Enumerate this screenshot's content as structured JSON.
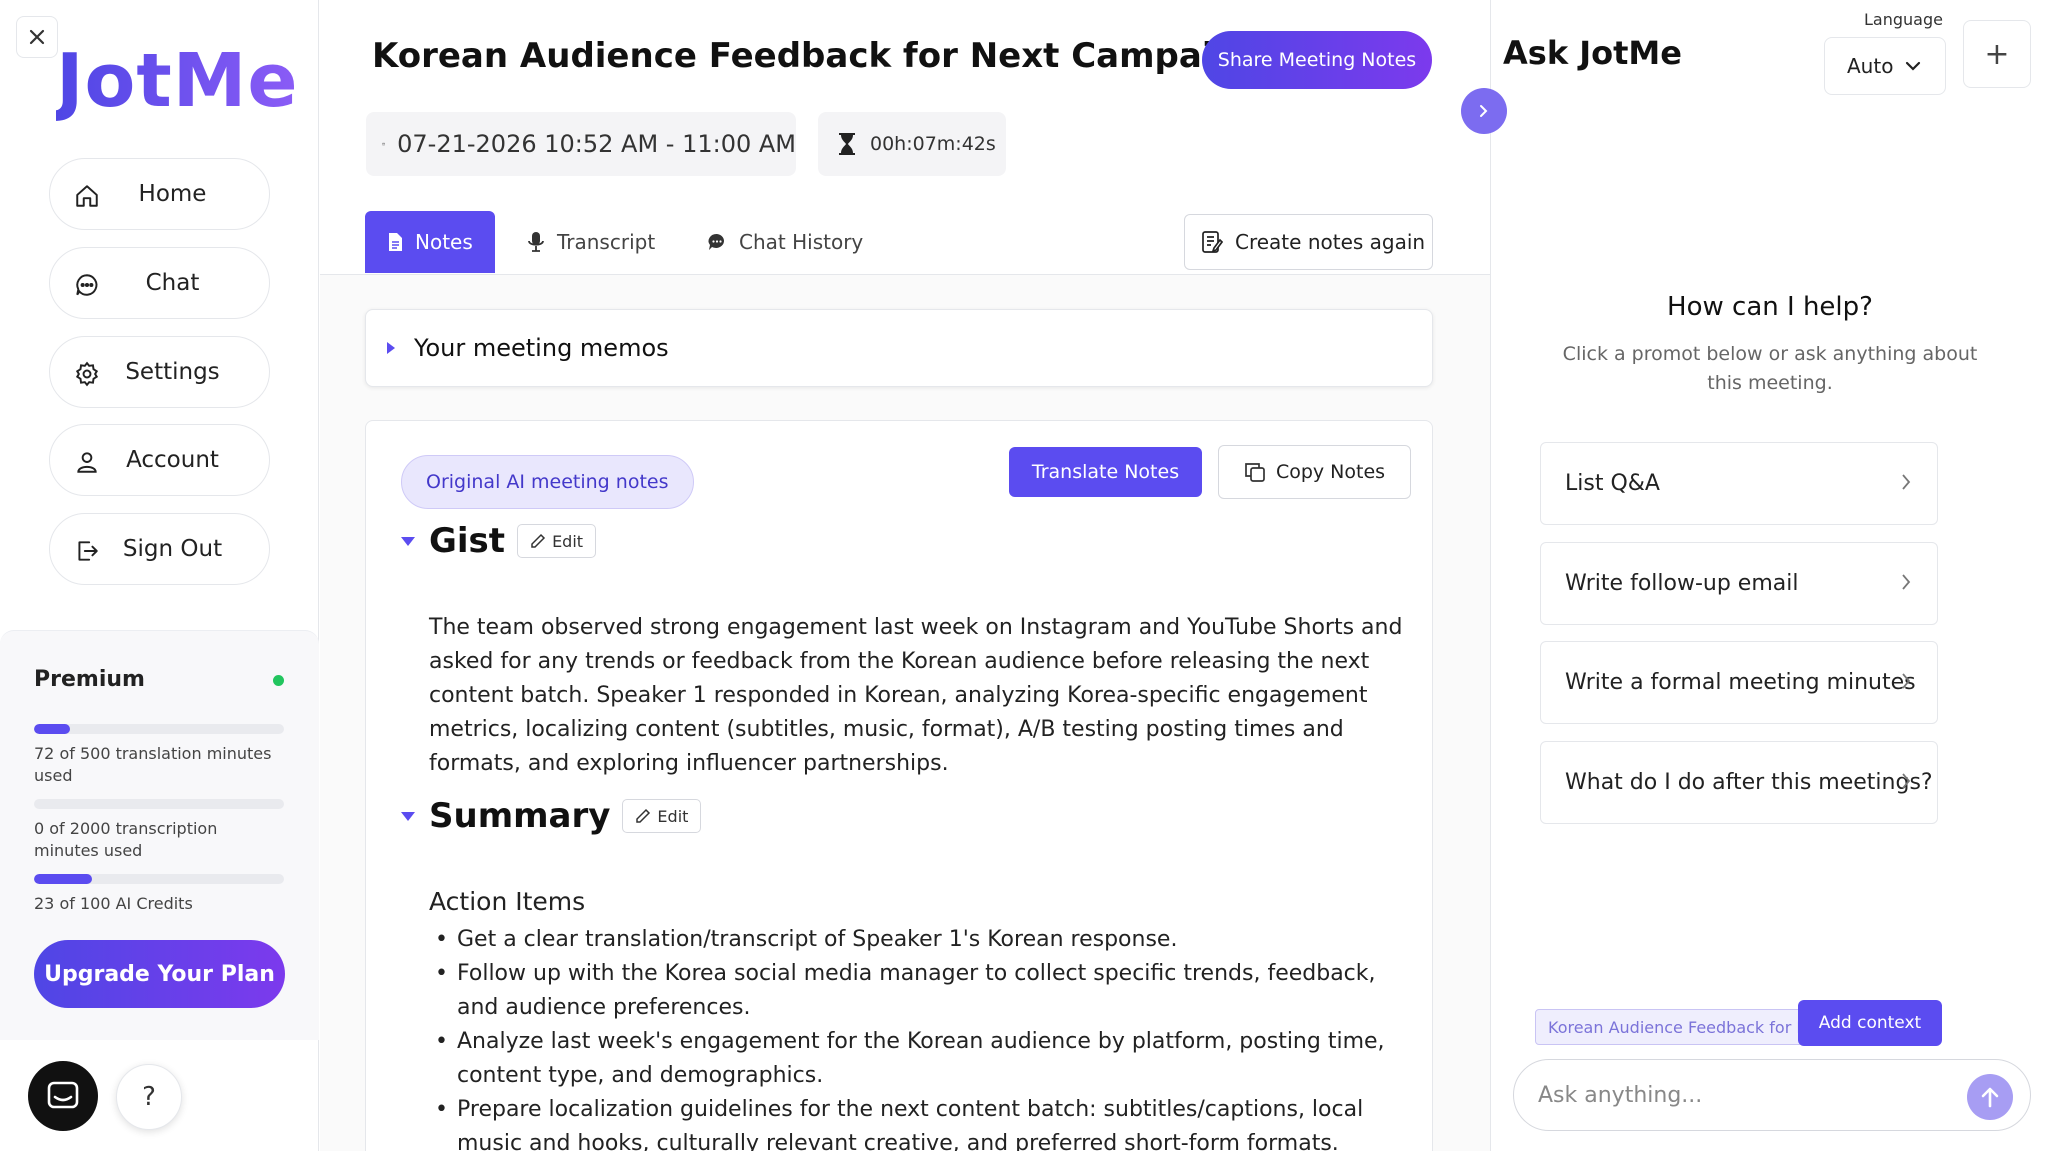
{
  "app": {
    "name": "JotMe"
  },
  "sidebar": {
    "items": [
      {
        "label": "Home",
        "icon": "home-icon"
      },
      {
        "label": "Chat",
        "icon": "chat-icon"
      },
      {
        "label": "Settings",
        "icon": "gear-icon"
      },
      {
        "label": "Account",
        "icon": "user-icon"
      },
      {
        "label": "Sign Out",
        "icon": "sign-out-icon"
      }
    ],
    "plan": {
      "name": "Premium",
      "status_color": "#22c55e",
      "translation_text": "72 of 500 translation minutes used",
      "translation_fraction": 0.144,
      "transcription_text": "0 of 2000 transcription minutes used",
      "transcription_fraction": 0,
      "credits_text": "23 of 100 AI Credits",
      "credits_fraction": 0.23,
      "upgrade_label": "Upgrade Your Plan"
    },
    "help_label": "?"
  },
  "meeting": {
    "title": "Korean Audience Feedback for Next Campaign",
    "share_label": "Share Meeting Notes",
    "datetime": "07-21-2026 10:52 AM - 11:00 AM",
    "duration": "00h:07m:42s"
  },
  "tabs": [
    {
      "label": "Notes",
      "active": true
    },
    {
      "label": "Transcript",
      "active": false
    },
    {
      "label": "Chat History",
      "active": false
    }
  ],
  "recreate_label": "Create notes again",
  "memos": {
    "title": "Your meeting memos"
  },
  "notes": {
    "original_label": "Original AI meeting notes",
    "translate_label": "Translate Notes",
    "copy_label": "Copy Notes",
    "edit_label": "Edit",
    "gist_title": "Gist",
    "gist_text": "The team observed strong engagement last week on Instagram and YouTube Shorts and asked for any trends or feedback from the Korean audience before releasing the next content batch. Speaker 1 responded in Korean, analyzing Korea-specific engagement metrics, localizing content (subtitles, music, format), A/B testing posting times and formats, and exploring influencer partnerships.",
    "summary_title": "Summary",
    "action_items_title": "Action Items",
    "action_items": [
      "Get a clear translation/transcript of Speaker 1's Korean response.",
      "Follow up with the Korea social media manager to collect specific trends, feedback, and audience preferences.",
      "Analyze last week's engagement for the Korean audience by platform, posting time, content type, and demographics.",
      "Prepare localization guidelines for the next content batch: subtitles/captions, local music and hooks, culturally relevant creative, and preferred short-form formats."
    ]
  },
  "assistant": {
    "title": "Ask JotMe",
    "language_label": "Language",
    "language_value": "Auto",
    "new_chat_label": "+",
    "help_title": "How can I help?",
    "help_subtitle": "Click a promot below or ask anything about this meeting.",
    "prompts": [
      "List Q&A",
      "Write follow-up email",
      "Write a formal meeting minutes",
      "What do I do after this meetings?"
    ],
    "context_value": "Korean Audience Feedback for Next Campaign",
    "add_context_label": "Add context",
    "input_placeholder": "Ask anything..."
  },
  "colors": {
    "accent": "#5b4cf0",
    "accent_light": "#e9e7fd",
    "status_green": "#22c55e"
  }
}
